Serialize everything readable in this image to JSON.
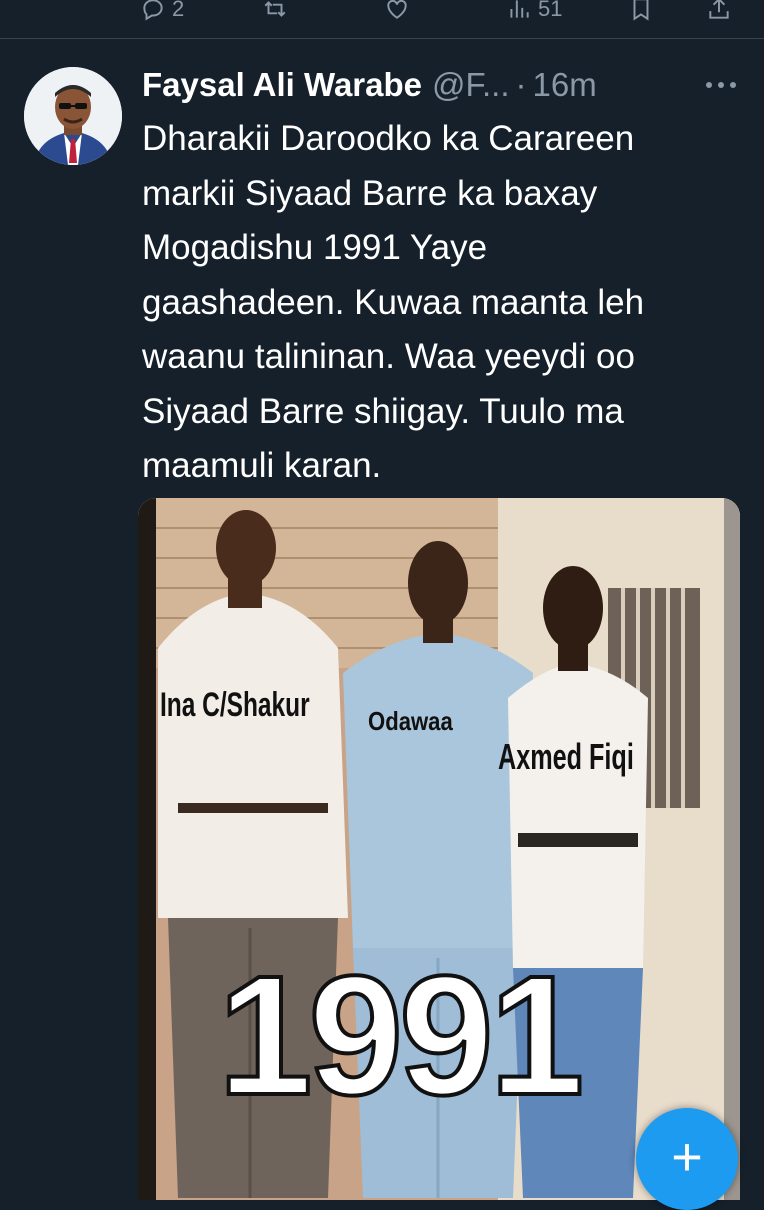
{
  "action_bar": {
    "reply_count": "2",
    "views_count": "51"
  },
  "tweet": {
    "author_name": "Faysal Ali Warabe",
    "author_handle": "@F...",
    "separator": "·",
    "timestamp": "16m",
    "text": "Dharakii Daroodko ka Carareen\nmarkii Siyaad Barre ka baxay\nMogadishu 1991 Yaye\ngaashadeen. Kuwaa maanta leh\nwaanu talininan. Waa yeeydi  oo\nSiyaad Barre shiigay. Tuulo ma\nmaamuli karan."
  },
  "media": {
    "labels": [
      "Ina C/Shakur",
      "Odawaa",
      "Axmed Fiqi"
    ],
    "year": "1991"
  },
  "fab": {
    "icon": "plus-icon"
  },
  "colors": {
    "background": "#15202b",
    "secondary_text": "#8b98a5",
    "accent": "#1d9bf0"
  }
}
